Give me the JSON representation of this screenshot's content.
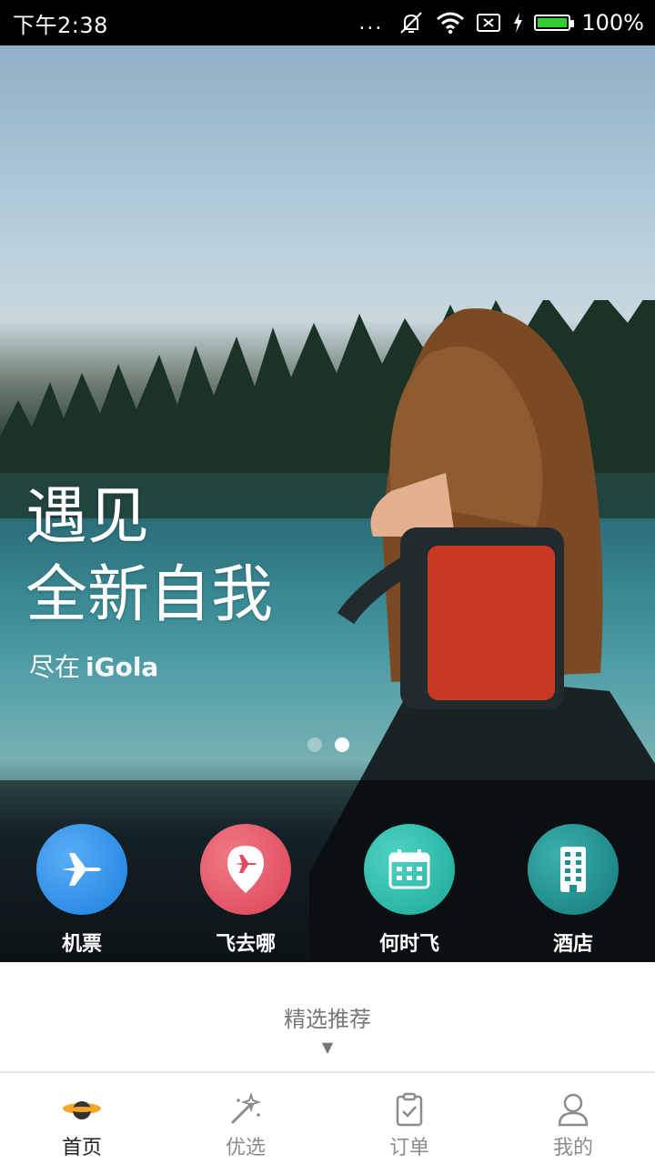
{
  "status_bar": {
    "time": "下午2:38",
    "battery": "100%",
    "dots": "..."
  },
  "hero": {
    "title_line1": "遇见",
    "title_line2": "全新自我",
    "subtitle_prefix": "尽在",
    "subtitle_brand": "iGola",
    "pager": {
      "count": 2,
      "active": 1
    }
  },
  "quick_nav": [
    {
      "label": "机票",
      "icon": "airplane-icon",
      "color": "#2f8fe8"
    },
    {
      "label": "飞去哪",
      "icon": "location-plane-icon",
      "color": "#e85466"
    },
    {
      "label": "何时飞",
      "icon": "calendar-icon",
      "color": "#26b9a9"
    },
    {
      "label": "酒店",
      "icon": "building-icon",
      "color": "#1f8f8f"
    }
  ],
  "recommend": {
    "label": "精选推荐",
    "arrow": "▼"
  },
  "bottom_nav": [
    {
      "label": "首页",
      "icon": "saturn-icon",
      "active": true
    },
    {
      "label": "优选",
      "icon": "magic-wand-icon",
      "active": false
    },
    {
      "label": "订单",
      "icon": "clipboard-check-icon",
      "active": false
    },
    {
      "label": "我的",
      "icon": "user-icon",
      "active": false
    }
  ],
  "colors": {
    "home_icon": "#f5a623",
    "inactive_text": "#8c8c8c",
    "active_text": "#222222"
  }
}
